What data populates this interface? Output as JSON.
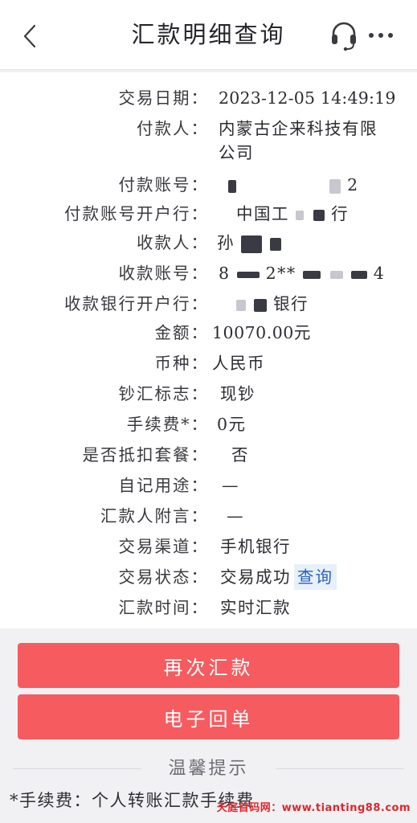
{
  "header": {
    "title": "汇款明细查询",
    "back_icon": "chevron-left-icon",
    "support_icon": "headset-icon",
    "more_icon": "more-horizontal-icon"
  },
  "details": [
    {
      "label": "交易日期：",
      "value": "2023-12-05 14:49:19"
    },
    {
      "label": "付款人：",
      "value": "内蒙古企来科技有限",
      "value_line2": "公司"
    },
    {
      "label": "付款账号：",
      "value_suffix": "2"
    },
    {
      "label": "付款账号开户行：",
      "value_prefix": "中国工",
      "value_suffix": "行"
    },
    {
      "label": "收款人：",
      "value_prefix": "孙"
    },
    {
      "label": "收款账号：",
      "value_prefix": "8",
      "value_mid": "2**",
      "value_suffix": "4"
    },
    {
      "label": "收款银行开户行：",
      "value_suffix": "银行"
    },
    {
      "label": "金额：",
      "value": "10070.00元"
    },
    {
      "label": "币种：",
      "value": "人民币"
    },
    {
      "label": "钞汇标志：",
      "value": "现钞"
    },
    {
      "label": "手续费*：",
      "value": "0元"
    },
    {
      "label": "是否抵扣套餐：",
      "value": "否"
    },
    {
      "label": "自记用途：",
      "value": "—"
    },
    {
      "label": "汇款人附言：",
      "value": "—"
    },
    {
      "label": "交易渠道：",
      "value": "手机银行"
    },
    {
      "label": "交易状态：",
      "value": "交易成功",
      "action": "查询"
    },
    {
      "label": "汇款时间：",
      "value": "实时汇款"
    }
  ],
  "buttons": {
    "remit_again": "再次汇款",
    "e_receipt": "电子回单"
  },
  "tips": {
    "title": "温馨提示",
    "text": "*手续费：个人转账汇款手续费"
  },
  "watermark": "天庭首码网：www.tianting88.com",
  "colors": {
    "primary_button": "#f55b5f",
    "link": "#2c63b8",
    "badge_bg": "#e7f0fb",
    "watermark": "#e0262b"
  }
}
